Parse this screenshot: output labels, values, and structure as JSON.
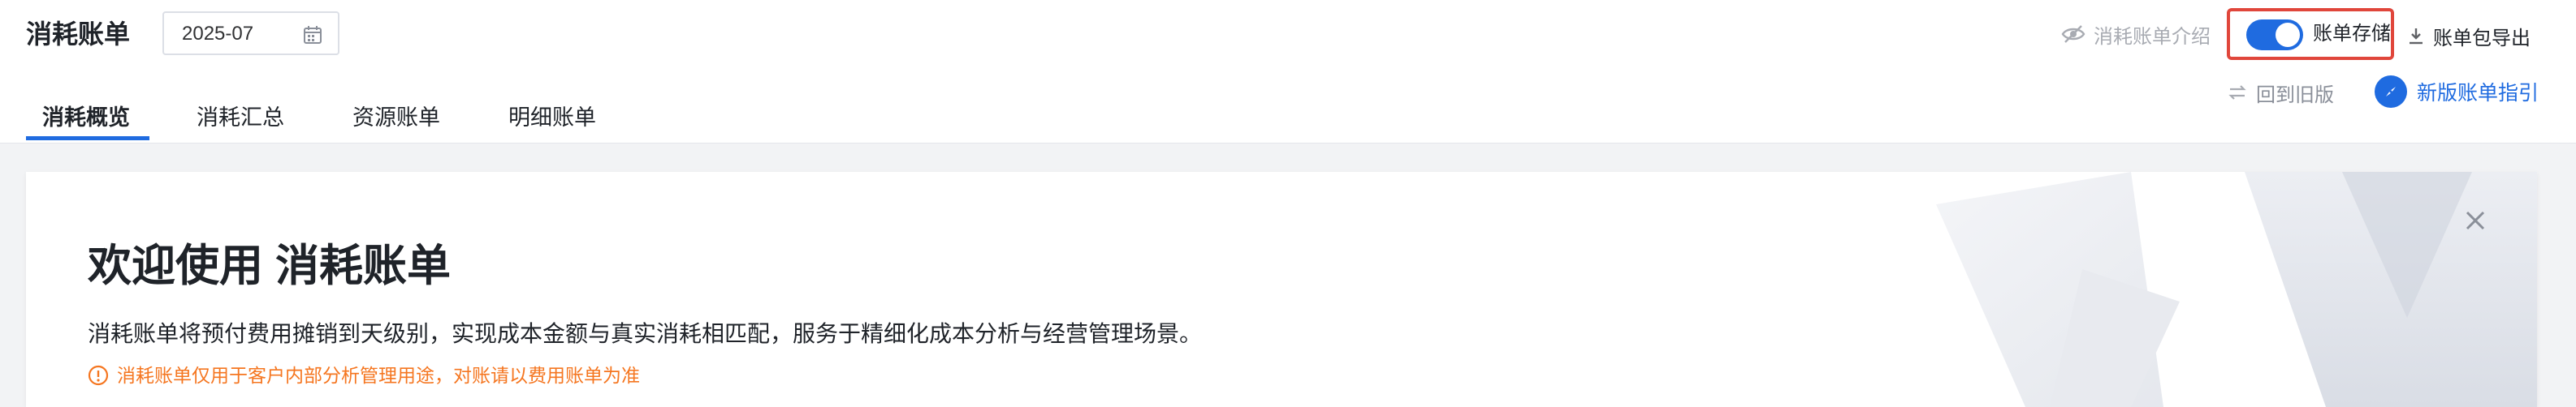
{
  "header": {
    "title": "消耗账单",
    "date_value": "2025-07",
    "intro_label": "消耗账单介绍",
    "toggle_label": "账单存储",
    "toggle_on": true,
    "export_label": "账单包导出"
  },
  "tabs": [
    {
      "label": "消耗概览",
      "active": true
    },
    {
      "label": "消耗汇总",
      "active": false
    },
    {
      "label": "资源账单",
      "active": false
    },
    {
      "label": "明细账单",
      "active": false
    }
  ],
  "actions": {
    "old_version_label": "回到旧版",
    "guide_label": "新版账单指引"
  },
  "welcome": {
    "title": "欢迎使用 消耗账单",
    "description": "消耗账单将预付费用摊销到天级别，实现成本金额与真实消耗相匹配，服务于精细化成本分析与经营管理场景。",
    "notice": "消耗账单仅用于客户内部分析管理用途，对账请以费用账单为准"
  },
  "colors": {
    "accent": "#1f6be0",
    "highlight_border": "#e0463b",
    "notice": "#f57620"
  },
  "icons": [
    "calendar-icon",
    "eye-off-icon",
    "download-icon",
    "swap-icon",
    "compass-icon",
    "info-icon",
    "close-icon"
  ]
}
